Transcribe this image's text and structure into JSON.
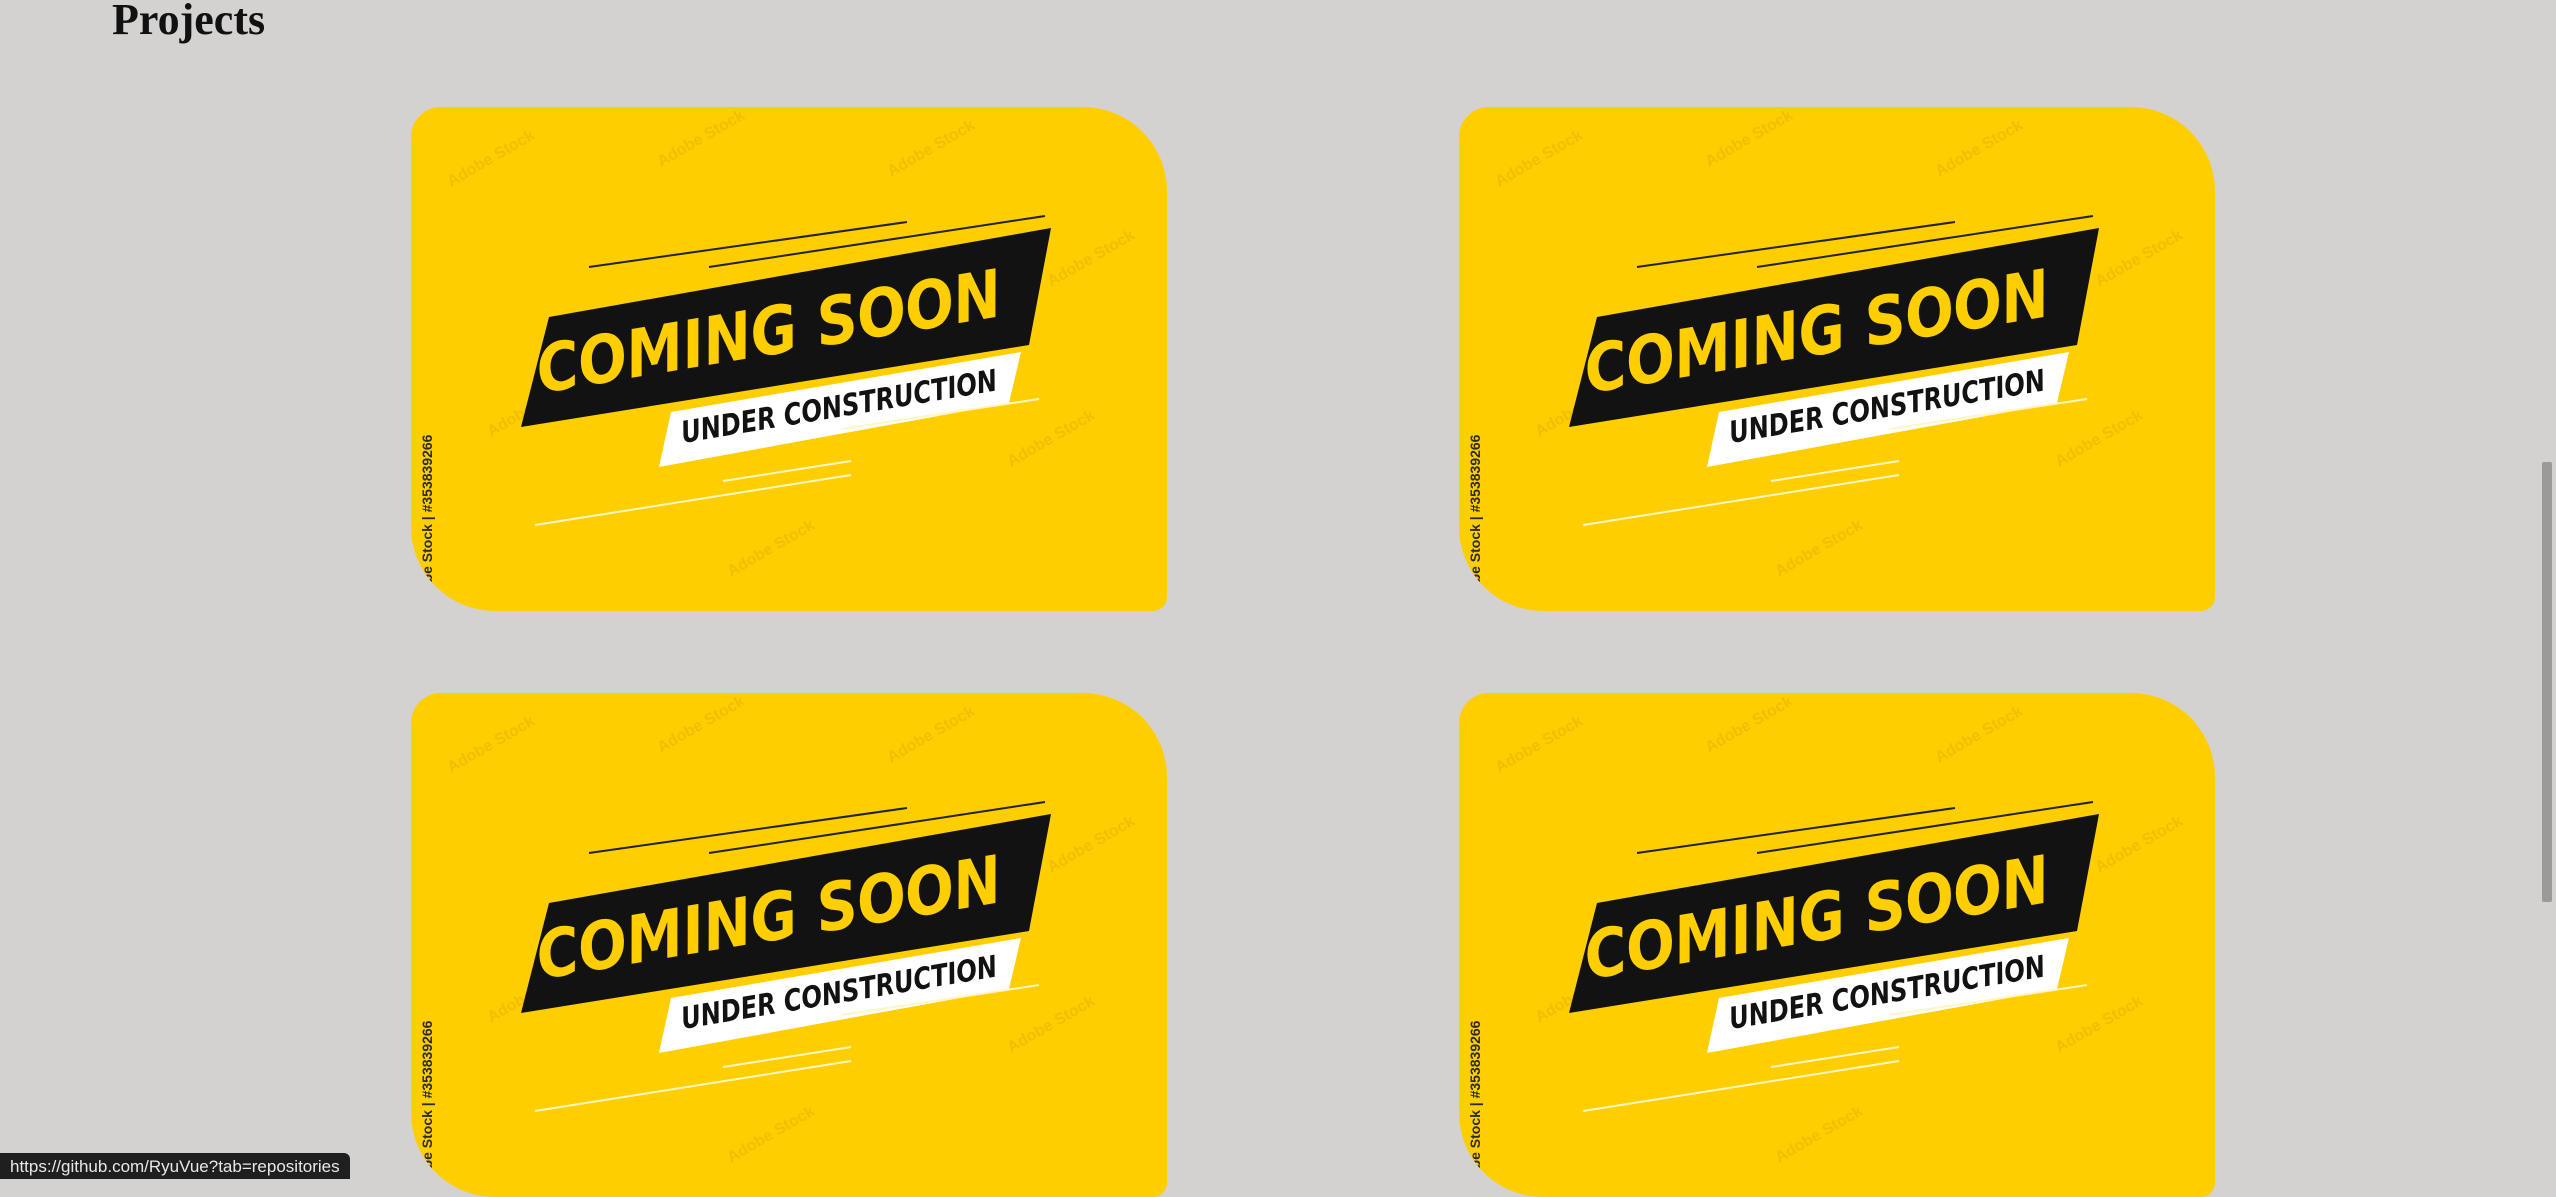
{
  "page": {
    "title": "Projects"
  },
  "projects": [
    {
      "headline": "COMING SOON",
      "subline": "UNDER CONSTRUCTION",
      "side_text": "obe Stock | #353839266",
      "watermark": "Adobe Stock"
    },
    {
      "headline": "COMING SOON",
      "subline": "UNDER CONSTRUCTION",
      "side_text": "obe Stock | #353839266",
      "watermark": "Adobe Stock"
    },
    {
      "headline": "COMING SOON",
      "subline": "UNDER CONSTRUCTION",
      "side_text": "obe Stock | #353839266",
      "watermark": "Adobe Stock"
    },
    {
      "headline": "COMING SOON",
      "subline": "UNDER CONSTRUCTION",
      "side_text": "obe Stock | #353839266",
      "watermark": "Adobe Stock"
    }
  ],
  "status_bar": {
    "url": "https://github.com/RyuVue?tab=repositories"
  },
  "colors": {
    "background": "#d4d2d1",
    "card_yellow": "#ffce00",
    "banner_black": "#121212",
    "headline_yellow": "#ffce00",
    "subline_white": "#ffffff"
  }
}
